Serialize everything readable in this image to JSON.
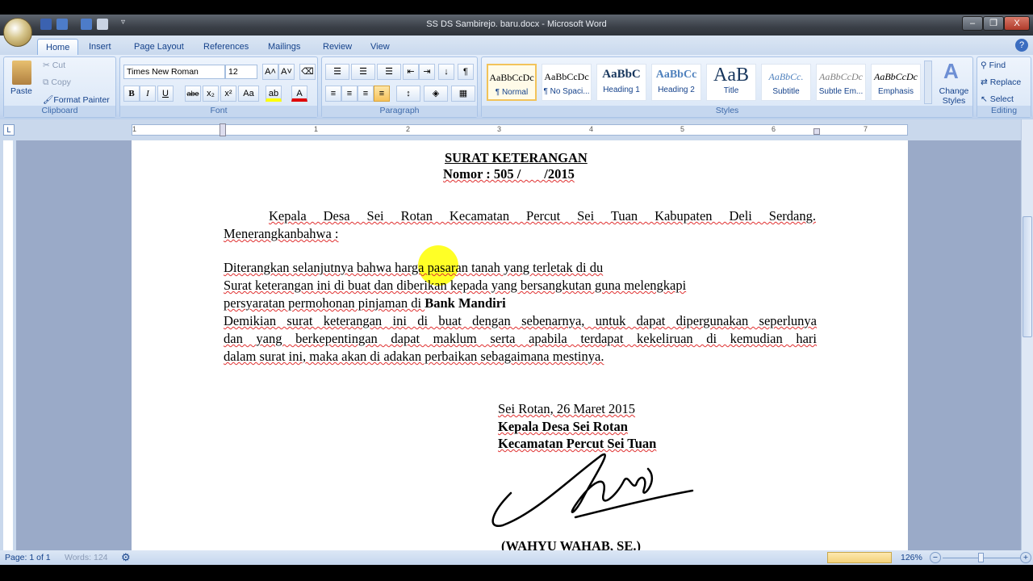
{
  "window": {
    "title": "SS DS Sambirejo. baru.docx - Microsoft Word",
    "minimize": "–",
    "restore": "❐",
    "close": "X"
  },
  "tabs": [
    "Home",
    "Insert",
    "Page Layout",
    "References",
    "Mailings",
    "Review",
    "View"
  ],
  "clipboard": {
    "paste": "Paste",
    "cut": "Cut",
    "copy": "Copy",
    "format_painter": "Format Painter",
    "label": "Clipboard"
  },
  "font": {
    "name": "Times New Roman",
    "size": "12",
    "label": "Font",
    "bold": "B",
    "italic": "I",
    "underline": "U",
    "strike": "abe",
    "sub": "x₂",
    "sup": "x²",
    "case": "Aa",
    "grow": "A˄",
    "shrink": "A˅",
    "color": "A",
    "highlight": "ab"
  },
  "paragraph": {
    "label": "Paragraph",
    "pilcrow": "¶"
  },
  "styles": {
    "label": "Styles",
    "items": [
      {
        "preview": "AaBbCcDc",
        "name": "¶ Normal"
      },
      {
        "preview": "AaBbCcDc",
        "name": "¶ No Spaci..."
      },
      {
        "preview": "AaBbC",
        "name": "Heading 1"
      },
      {
        "preview": "AaBbCc",
        "name": "Heading 2"
      },
      {
        "preview": "AaB",
        "name": "Title"
      },
      {
        "preview": "AaBbCc.",
        "name": "Subtitle"
      },
      {
        "preview": "AaBbCcDc",
        "name": "Subtle Em..."
      },
      {
        "preview": "AaBbCcDc",
        "name": "Emphasis"
      }
    ],
    "change": "Change Styles"
  },
  "editing": {
    "label": "Editing",
    "find": "Find",
    "replace": "Replace",
    "select": "Select"
  },
  "ruler": {
    "ticks": [
      "1",
      "1",
      "2",
      "3",
      "4",
      "5",
      "6",
      "7"
    ]
  },
  "document": {
    "title": "SURAT KETERANGAN",
    "number": "Nomor : 505 /       /2015",
    "p1_line1": "Kepala Desa Sei Rotan Kecamatan Percut Sei Tuan Kabupaten Deli Serdang.",
    "p1_line2": "Menerangkanbahwa :",
    "l1": "Diterangkan selanjutnya bahwa harga pasaran tanah yang terletak di du",
    "l2": "Surat keterangan ini di buat dan diberikan kepada yang bersangkutan guna melengkapi",
    "l3a": "persyaratan permohonan pinjaman di ",
    "l3b": "Bank  Mandiri",
    "l4": "Demikian surat keterangan ini di buat dengan sebenarnya, untuk dapat dipergunakan seperlunya",
    "l5": "dan yang berkepentingan dapat maklum serta apabila terdapat kekeliruan di kemudian hari",
    "l6": "dalam surat ini, maka akan di adakan perbaikan sebagaimana mestinya.",
    "place_date": "Sei Rotan, 26 Maret 2015",
    "sig1": "Kepala  Desa Sei Rotan",
    "sig2": "Kecamatan  Percut Sei Tuan",
    "signer": "(WAHYU  WAHAB,  SE.)"
  },
  "status": {
    "page": "Page: 1 of 1",
    "words": "Words: 124",
    "zoom": "126%",
    "minus": "−",
    "plus": "+"
  },
  "colors": {
    "ribbon": "#c7d9f1",
    "highlight_cursor": "#ffff00"
  }
}
